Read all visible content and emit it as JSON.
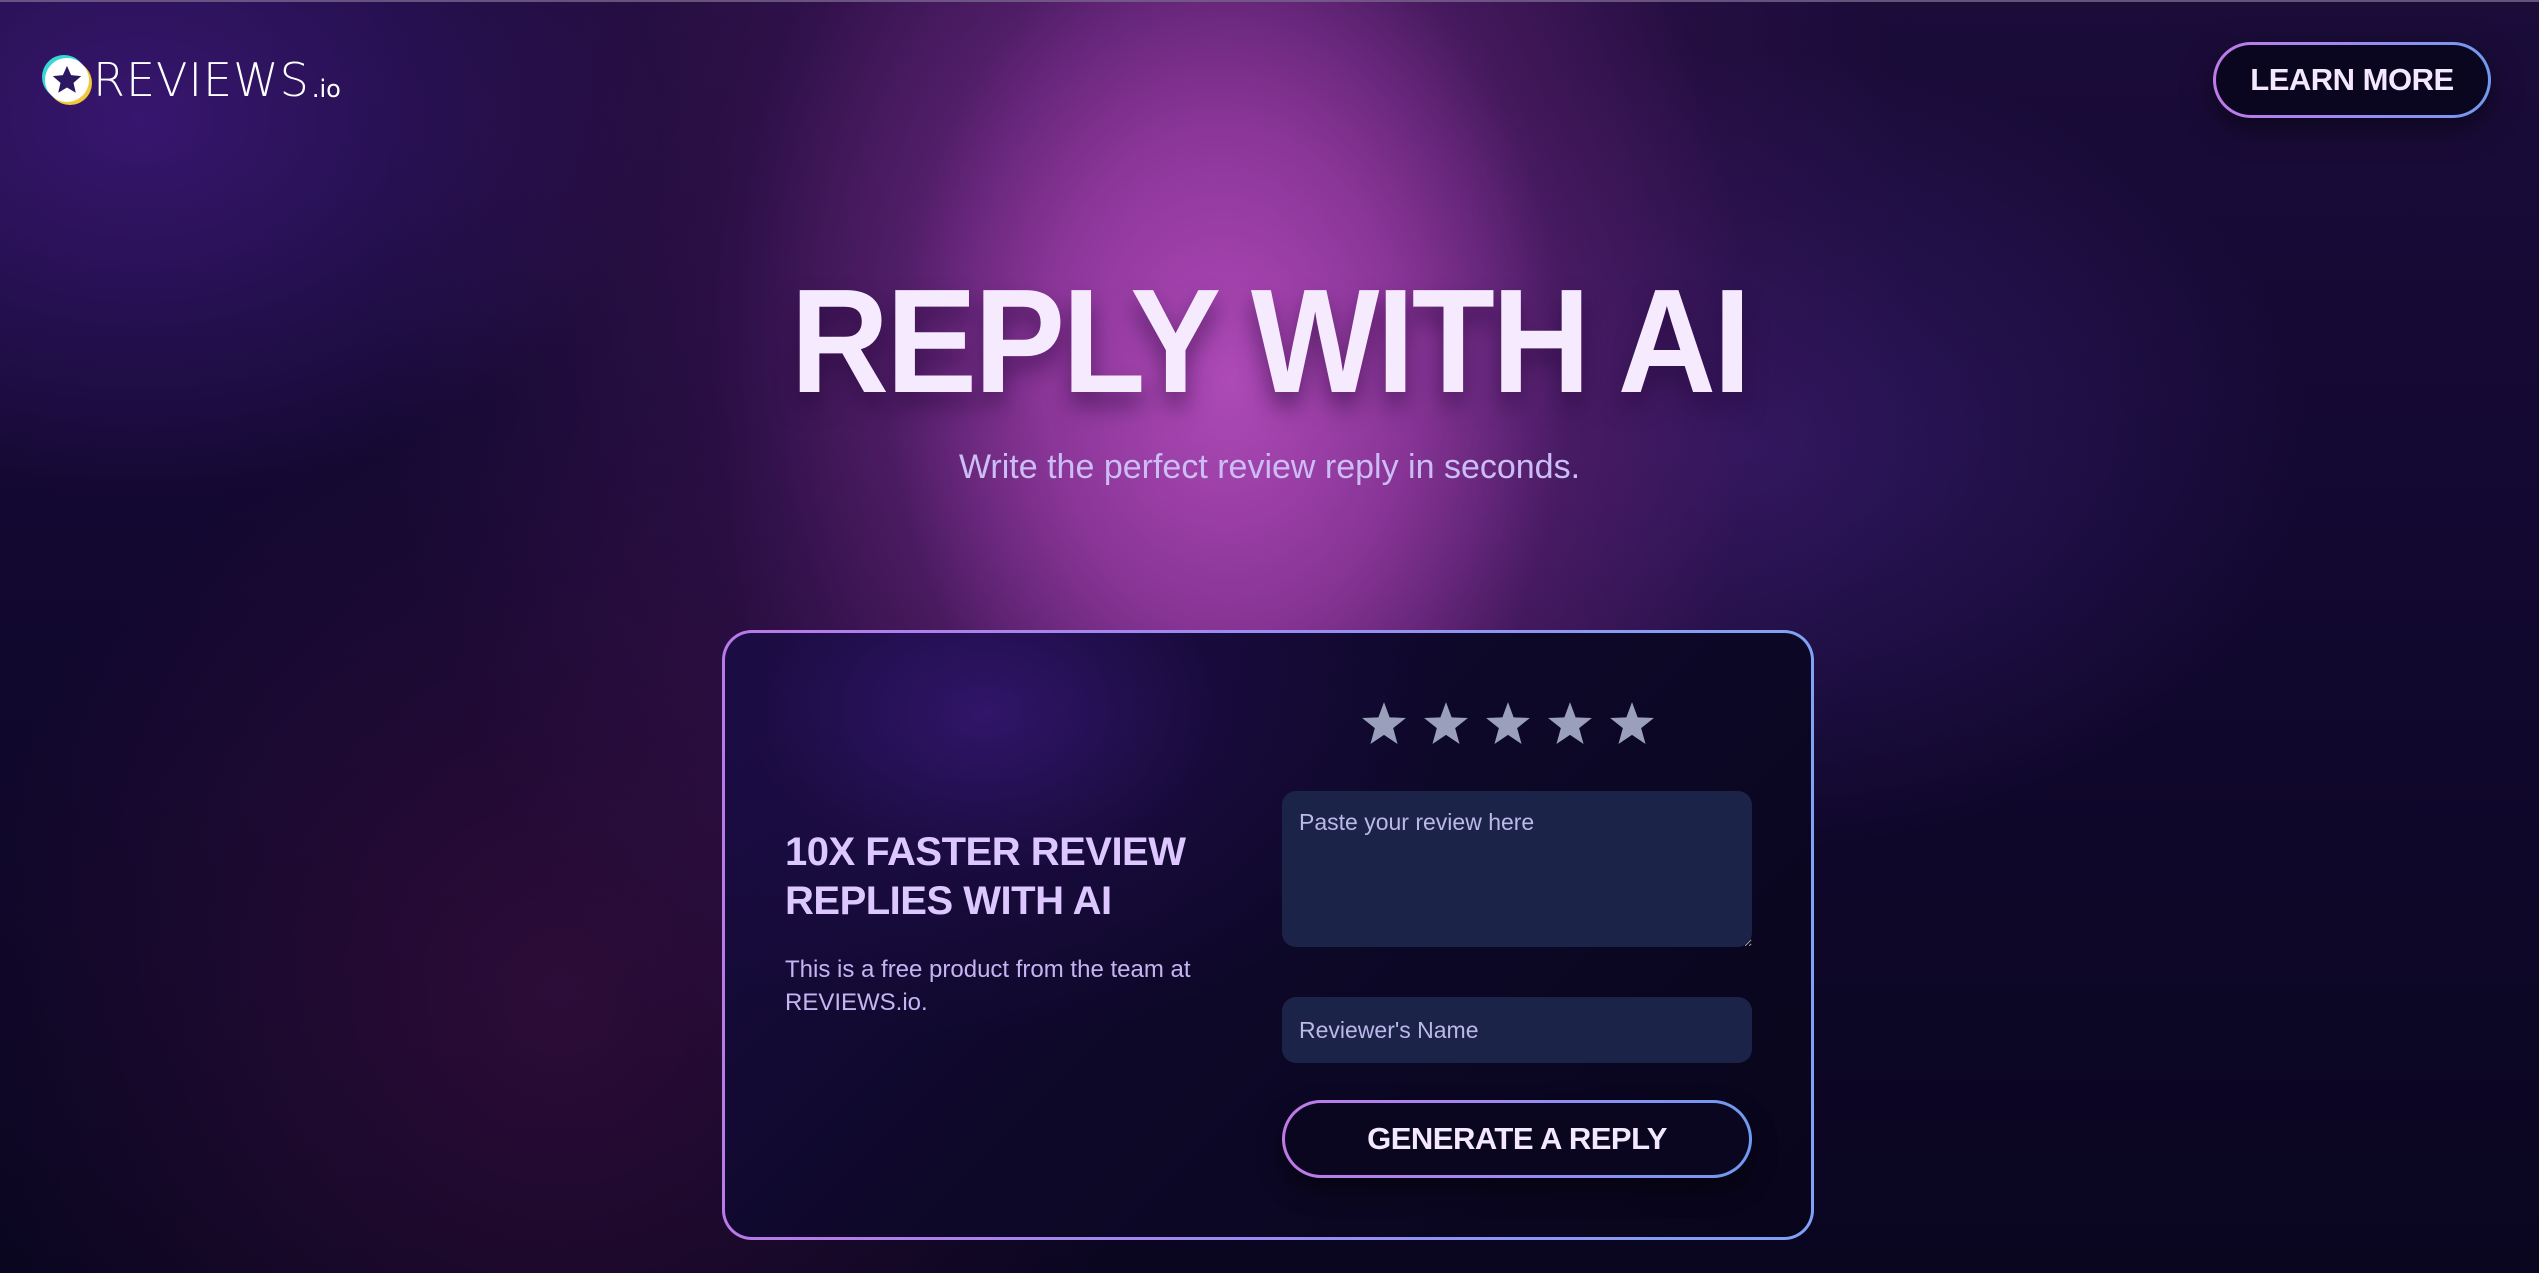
{
  "brand": {
    "name": "REVIEWS",
    "suffix": ".io",
    "logo_icon": "star-badge-icon"
  },
  "header": {
    "learn_more_label": "LEARN MORE"
  },
  "hero": {
    "title": "REPLY WITH AI",
    "subtitle": "Write the perfect review reply in seconds."
  },
  "card": {
    "heading": "10X FASTER REVIEW REPLIES WITH AI",
    "description": "This is a free product from the team at REVIEWS.io.",
    "rating": {
      "max_stars": 5,
      "selected": 0,
      "icon": "star-icon"
    },
    "review_input": {
      "value": "",
      "placeholder": "Paste your review here"
    },
    "name_input": {
      "value": "",
      "placeholder": "Reviewer's Name"
    },
    "generate_label": "GENERATE A REPLY"
  },
  "colors": {
    "accent_gradient_start": "#c07ae8",
    "accent_gradient_end": "#6f9af0",
    "button_bg": "#0b0620",
    "input_bg": "#1b2349",
    "star_color": "#9aa0bc",
    "title_color": "#f6eaff",
    "subtitle_color": "#cdbdf7"
  }
}
